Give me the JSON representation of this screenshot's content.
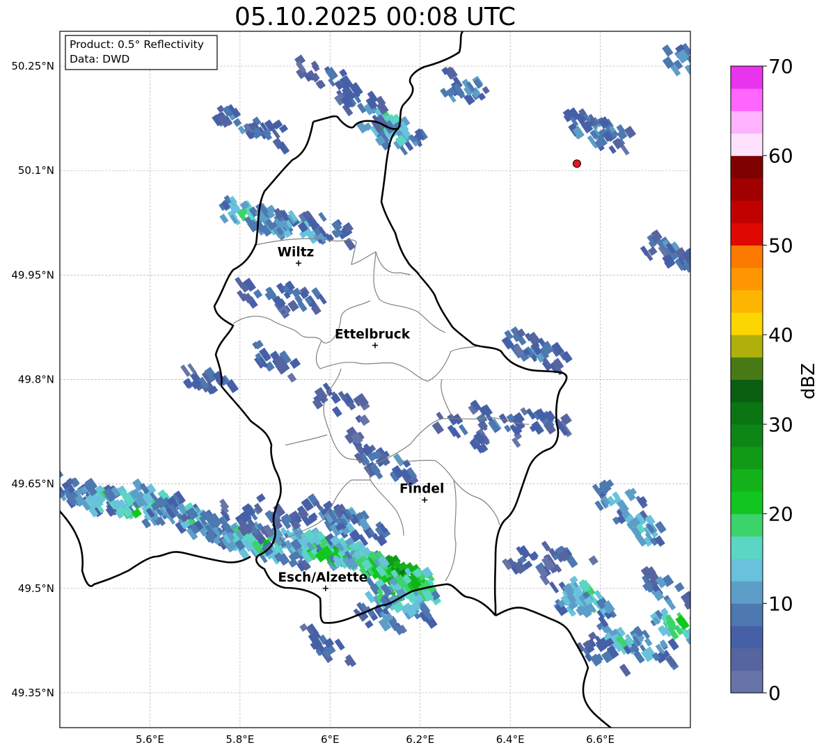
{
  "title": "05.10.2025 00:08 UTC",
  "info_box": {
    "line1": "Product: 0.5° Reflectivity",
    "line2": "Data: DWD"
  },
  "axes": {
    "lon_range": [
      5.4,
      6.8
    ],
    "lat_range": [
      49.3,
      50.3
    ],
    "x_ticks": [
      {
        "value": 5.6,
        "label": "5.6°E"
      },
      {
        "value": 5.8,
        "label": "5.8°E"
      },
      {
        "value": 6.0,
        "label": "6°E"
      },
      {
        "value": 6.2,
        "label": "6.2°E"
      },
      {
        "value": 6.4,
        "label": "6.4°E"
      },
      {
        "value": 6.6,
        "label": "6.6°E"
      }
    ],
    "y_ticks": [
      {
        "value": 50.25,
        "label": "50.25°N"
      },
      {
        "value": 50.1,
        "label": "50.1°N"
      },
      {
        "value": 49.95,
        "label": "49.95°N"
      },
      {
        "value": 49.8,
        "label": "49.8°N"
      },
      {
        "value": 49.65,
        "label": "49.65°N"
      },
      {
        "value": 49.5,
        "label": "49.5°N"
      },
      {
        "value": 49.35,
        "label": "49.35°N"
      }
    ]
  },
  "cities": [
    {
      "name": "Wiltz",
      "lon": 5.93,
      "lat": 49.967
    },
    {
      "name": "Ettelbruck",
      "lon": 6.1,
      "lat": 49.849
    },
    {
      "name": "Findel",
      "lon": 6.21,
      "lat": 49.627
    },
    {
      "name": "Esch/Alzette",
      "lon": 5.99,
      "lat": 49.5
    }
  ],
  "radar_site": {
    "lon": 6.548,
    "lat": 50.11,
    "color": "#e8141e"
  },
  "colorbar": {
    "label": "dBZ",
    "min": 0,
    "max": 70,
    "step": 2.5,
    "ticks": [
      {
        "value": 0,
        "label": "0"
      },
      {
        "value": 10,
        "label": "10"
      },
      {
        "value": 20,
        "label": "20"
      },
      {
        "value": 30,
        "label": "30"
      },
      {
        "value": 40,
        "label": "40"
      },
      {
        "value": 50,
        "label": "50"
      },
      {
        "value": 60,
        "label": "60"
      },
      {
        "value": 70,
        "label": "70"
      }
    ],
    "colors": [
      "#6674a8",
      "#5665a0",
      "#4660a8",
      "#4d78b0",
      "#5d9ec8",
      "#68c2dc",
      "#5cd6c4",
      "#3dd36b",
      "#11c71f",
      "#13b21a",
      "#109a16",
      "#0d8615",
      "#0c7513",
      "#0a5e10",
      "#477a15",
      "#afb10a",
      "#fdd501",
      "#fdb501",
      "#fd9601",
      "#fd7a01",
      "#e00802",
      "#c10000",
      "#a00000",
      "#7e0000",
      "#ffe1fe",
      "#ffb2fe",
      "#ff66fe",
      "#e933ee"
    ]
  },
  "radar_cells": [
    {
      "lon": 5.42,
      "lat": 49.64,
      "dbz": 12
    },
    {
      "lon": 5.46,
      "lat": 49.63,
      "dbz": 16
    },
    {
      "lon": 5.5,
      "lat": 49.63,
      "dbz": 20
    },
    {
      "lon": 5.55,
      "lat": 49.62,
      "dbz": 22
    },
    {
      "lon": 5.6,
      "lat": 49.63,
      "dbz": 18
    },
    {
      "lon": 5.64,
      "lat": 49.61,
      "dbz": 14
    },
    {
      "lon": 5.68,
      "lat": 49.6,
      "dbz": 18
    },
    {
      "lon": 5.72,
      "lat": 49.59,
      "dbz": 12
    },
    {
      "lon": 5.76,
      "lat": 49.58,
      "dbz": 16
    },
    {
      "lon": 5.8,
      "lat": 49.57,
      "dbz": 20
    },
    {
      "lon": 5.84,
      "lat": 49.57,
      "dbz": 22
    },
    {
      "lon": 5.88,
      "lat": 49.56,
      "dbz": 14
    },
    {
      "lon": 5.92,
      "lat": 49.57,
      "dbz": 18
    },
    {
      "lon": 5.96,
      "lat": 49.56,
      "dbz": 22
    },
    {
      "lon": 6.0,
      "lat": 49.56,
      "dbz": 24
    },
    {
      "lon": 6.04,
      "lat": 49.55,
      "dbz": 20
    },
    {
      "lon": 6.08,
      "lat": 49.54,
      "dbz": 22
    },
    {
      "lon": 6.12,
      "lat": 49.53,
      "dbz": 30
    },
    {
      "lon": 6.15,
      "lat": 49.52,
      "dbz": 32
    },
    {
      "lon": 6.18,
      "lat": 49.51,
      "dbz": 24
    },
    {
      "lon": 6.13,
      "lat": 49.49,
      "dbz": 22
    },
    {
      "lon": 6.16,
      "lat": 49.48,
      "dbz": 16
    },
    {
      "lon": 6.1,
      "lat": 49.46,
      "dbz": 10
    },
    {
      "lon": 5.97,
      "lat": 49.61,
      "dbz": 10
    },
    {
      "lon": 6.02,
      "lat": 49.6,
      "dbz": 14
    },
    {
      "lon": 6.06,
      "lat": 49.59,
      "dbz": 12
    },
    {
      "lon": 5.88,
      "lat": 49.61,
      "dbz": 8
    },
    {
      "lon": 5.8,
      "lat": 49.6,
      "dbz": 8
    },
    {
      "lon": 5.98,
      "lat": 49.42,
      "dbz": 8
    },
    {
      "lon": 6.56,
      "lat": 49.49,
      "dbz": 20
    },
    {
      "lon": 6.54,
      "lat": 49.48,
      "dbz": 16
    },
    {
      "lon": 6.64,
      "lat": 49.43,
      "dbz": 18
    },
    {
      "lon": 6.7,
      "lat": 49.42,
      "dbz": 14
    },
    {
      "lon": 6.76,
      "lat": 49.45,
      "dbz": 22
    },
    {
      "lon": 6.74,
      "lat": 49.5,
      "dbz": 12
    },
    {
      "lon": 6.6,
      "lat": 49.41,
      "dbz": 10
    },
    {
      "lon": 6.43,
      "lat": 49.54,
      "dbz": 8
    },
    {
      "lon": 6.52,
      "lat": 49.54,
      "dbz": 8
    },
    {
      "lon": 5.78,
      "lat": 50.17,
      "dbz": 10
    },
    {
      "lon": 5.85,
      "lat": 50.16,
      "dbz": 8
    },
    {
      "lon": 6.11,
      "lat": 50.17,
      "dbz": 20
    },
    {
      "lon": 6.14,
      "lat": 50.15,
      "dbz": 14
    },
    {
      "lon": 5.8,
      "lat": 50.04,
      "dbz": 18
    },
    {
      "lon": 5.86,
      "lat": 50.03,
      "dbz": 12
    },
    {
      "lon": 5.92,
      "lat": 50.02,
      "dbz": 16
    },
    {
      "lon": 5.98,
      "lat": 50.02,
      "dbz": 10
    },
    {
      "lon": 6.43,
      "lat": 49.85,
      "dbz": 12
    },
    {
      "lon": 6.46,
      "lat": 49.84,
      "dbz": 8
    },
    {
      "lon": 6.36,
      "lat": 49.74,
      "dbz": 10
    },
    {
      "lon": 6.46,
      "lat": 49.74,
      "dbz": 8
    },
    {
      "lon": 6.28,
      "lat": 49.73,
      "dbz": 8
    },
    {
      "lon": 6.12,
      "lat": 49.68,
      "dbz": 12
    },
    {
      "lon": 6.08,
      "lat": 49.7,
      "dbz": 8
    },
    {
      "lon": 6.01,
      "lat": 49.77,
      "dbz": 8
    },
    {
      "lon": 5.72,
      "lat": 49.8,
      "dbz": 8
    },
    {
      "lon": 6.74,
      "lat": 49.99,
      "dbz": 10
    },
    {
      "lon": 6.78,
      "lat": 49.97,
      "dbz": 8
    },
    {
      "lon": 6.57,
      "lat": 50.16,
      "dbz": 14
    },
    {
      "lon": 6.6,
      "lat": 50.16,
      "dbz": 10
    },
    {
      "lon": 6.29,
      "lat": 50.22,
      "dbz": 12
    },
    {
      "lon": 6.78,
      "lat": 50.26,
      "dbz": 12
    },
    {
      "lon": 5.97,
      "lat": 50.24,
      "dbz": 8
    },
    {
      "lon": 6.06,
      "lat": 50.2,
      "dbz": 8
    },
    {
      "lon": 6.63,
      "lat": 49.63,
      "dbz": 12
    },
    {
      "lon": 6.68,
      "lat": 49.59,
      "dbz": 16
    },
    {
      "lon": 5.84,
      "lat": 49.92,
      "dbz": 8
    },
    {
      "lon": 5.92,
      "lat": 49.92,
      "dbz": 8
    },
    {
      "lon": 5.86,
      "lat": 49.83,
      "dbz": 8
    }
  ]
}
